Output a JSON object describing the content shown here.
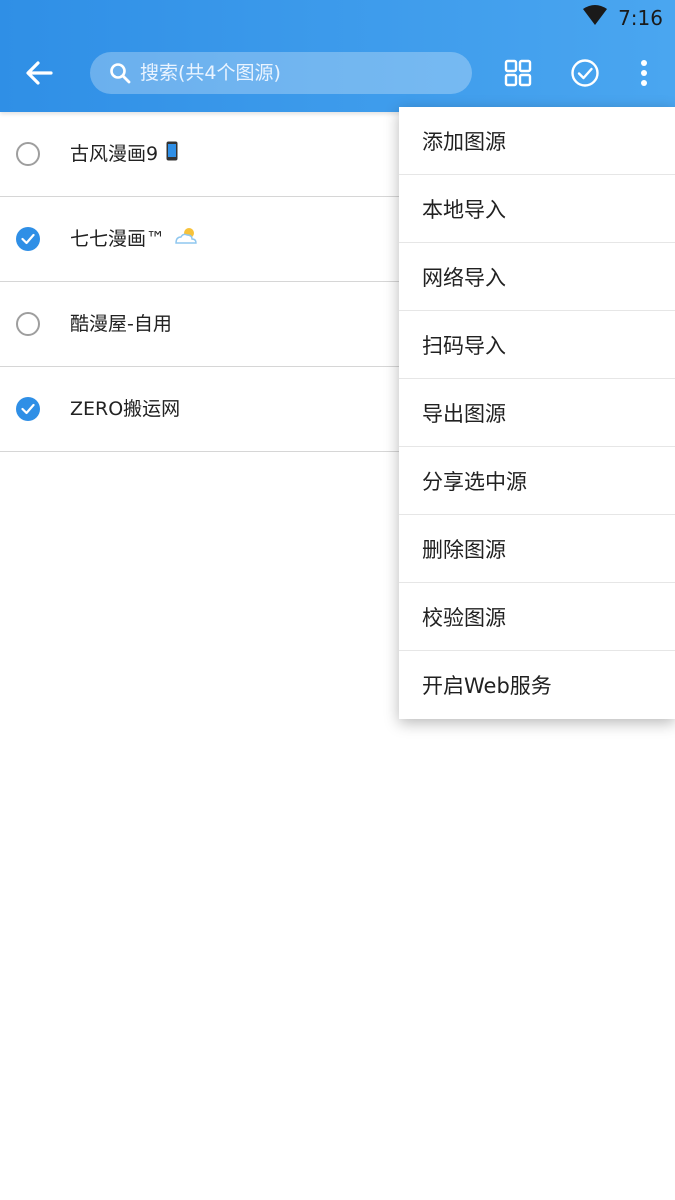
{
  "status_bar": {
    "time": "7:16",
    "icons": [
      "wifi-icon"
    ]
  },
  "app_bar": {
    "back_icon": "arrow-left-icon",
    "search": {
      "placeholder": "搜索(共4个图源)",
      "value": "",
      "icon": "search-icon"
    },
    "actions": [
      "grid-view-icon",
      "check-circle-icon",
      "more-vert-icon"
    ]
  },
  "sources": [
    {
      "name": "古风漫画9",
      "checked": false,
      "emoji": "mobile-phone"
    },
    {
      "name": "七七漫画™",
      "checked": true,
      "emoji": "sun-behind-cloud"
    },
    {
      "name": "酷漫屋-自用",
      "checked": false
    },
    {
      "name": "ZERO搬运网",
      "checked": true
    }
  ],
  "menu": {
    "items": [
      "添加图源",
      "本地导入",
      "网络导入",
      "扫码导入",
      "导出图源",
      "分享选中源",
      "删除图源",
      "校验图源",
      "开启Web服务"
    ]
  },
  "colors": {
    "primary": "#2f8fe6",
    "accent": "#4aa6f0"
  }
}
